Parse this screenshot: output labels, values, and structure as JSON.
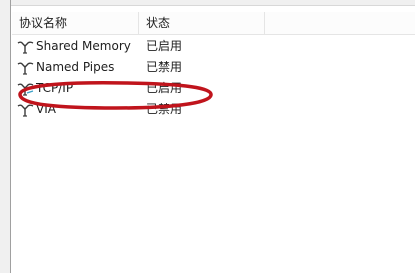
{
  "columns": {
    "name": "协议名称",
    "status": "状态"
  },
  "protocols": [
    {
      "name": "Shared Memory",
      "status": "已启用",
      "icon": "protocol-icon"
    },
    {
      "name": "Named Pipes",
      "status": "已禁用",
      "icon": "protocol-icon"
    },
    {
      "name": "TCP/IP",
      "status": "已启用",
      "icon": "protocol-icon"
    },
    {
      "name": "VIA",
      "status": "已禁用",
      "icon": "protocol-icon"
    }
  ],
  "colors": {
    "annotation_ellipse": "#c0141c",
    "text": "#1e1e1e",
    "grid_line": "#e5e5e5"
  }
}
